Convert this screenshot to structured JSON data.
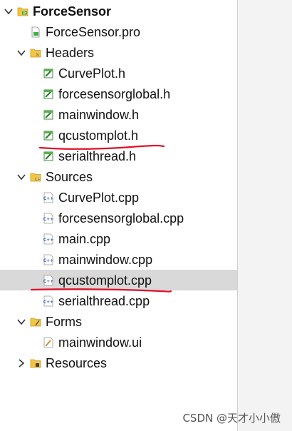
{
  "tree": {
    "project": {
      "label": "ForceSensor"
    },
    "pro_file": {
      "label": "ForceSensor.pro"
    },
    "headers": {
      "label": "Headers",
      "items": [
        "CurvePlot.h",
        "forcesensorglobal.h",
        "mainwindow.h",
        "qcustomplot.h",
        "serialthread.h"
      ]
    },
    "sources": {
      "label": "Sources",
      "items": [
        "CurvePlot.cpp",
        "forcesensorglobal.cpp",
        "main.cpp",
        "mainwindow.cpp",
        "qcustomplot.cpp",
        "serialthread.cpp"
      ]
    },
    "forms": {
      "label": "Forms",
      "items": [
        "mainwindow.ui"
      ]
    },
    "resources": {
      "label": "Resources"
    }
  },
  "selected_item": "qcustomplot.cpp",
  "annotation_color": "#e0102a",
  "watermark": "CSDN @天才小小傲"
}
